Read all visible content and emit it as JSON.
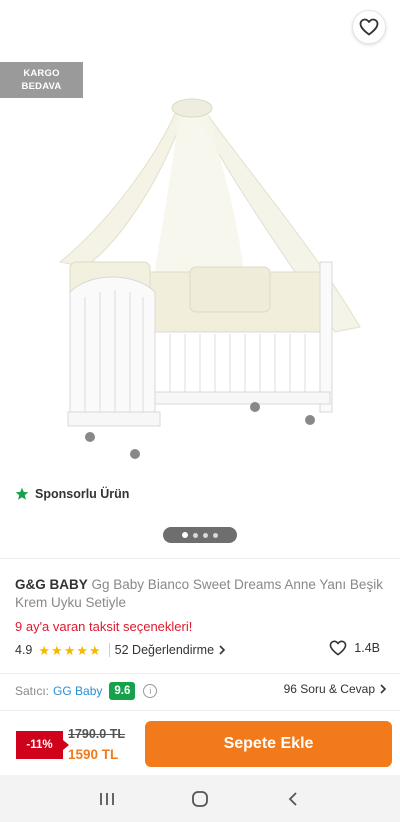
{
  "header": {
    "back_icon": "arrow-left-icon",
    "share_icon": "share-icon",
    "favorite_icon": "heart-icon"
  },
  "badge": {
    "line1": "KARGO",
    "line2": "BEDAVA"
  },
  "gallery": {
    "image_alt": "Beşik",
    "sponsored_label": "Sponsorlu Ürün",
    "dot_count": 4,
    "active_dot": 0
  },
  "product": {
    "brand": "G&G BABY",
    "name": "Gg Baby Bianco Sweet Dreams Anne Yanı Beşik Krem Uyku Setiyle",
    "installment_text": "9 ay'a varan taksit seçenekleri!",
    "rating_value": "4.9",
    "stars": 5,
    "reviews_label": "52 Değerlendirme",
    "likes": "1.4B"
  },
  "seller": {
    "label": "Satıcı:",
    "name": "GG Baby",
    "score": "9.6",
    "qa_label": "96 Soru & Cevap"
  },
  "price": {
    "discount": "-11%",
    "old_price": "1790.0 TL",
    "new_price": "1590 TL",
    "cta": "Sepete Ekle"
  },
  "colors": {
    "brand_orange": "#f27a1a",
    "discount_red": "#d0021b",
    "seller_score_green": "#16a24a",
    "link_blue": "#2a8fd6",
    "star_yellow": "#f5b800"
  }
}
